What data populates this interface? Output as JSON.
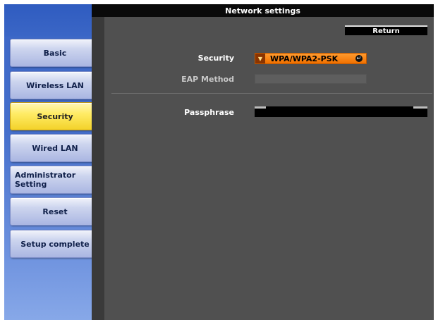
{
  "window": {
    "title": "Network settings"
  },
  "toolbar": {
    "return_label": "Return"
  },
  "sidebar": {
    "items": [
      {
        "label": "Basic"
      },
      {
        "label": "Wireless LAN"
      },
      {
        "label": "Security"
      },
      {
        "label": "Wired LAN"
      },
      {
        "label": "Administrator\nSetting"
      },
      {
        "label": "Reset"
      },
      {
        "label": "Setup complete"
      }
    ],
    "active": "Security"
  },
  "form": {
    "security": {
      "label": "Security",
      "value": "WPA/WPA2-PSK"
    },
    "eap_method": {
      "label": "EAP Method",
      "value": ""
    },
    "passphrase": {
      "label": "Passphrase",
      "value": ""
    }
  },
  "colors": {
    "sidebar_blue": "#3b66c6",
    "active_yellow": "#ffec66",
    "panel_gray": "#505050",
    "select_orange": "#f07000"
  }
}
